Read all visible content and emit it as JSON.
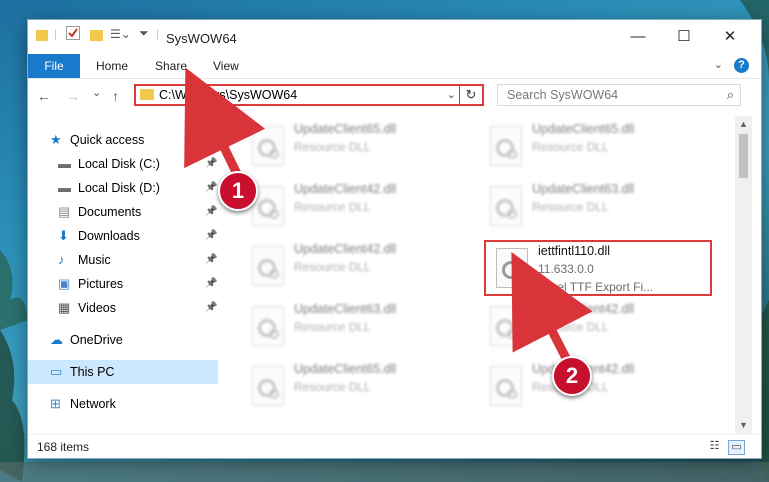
{
  "window": {
    "title": "SysWOW64",
    "controls": {
      "minimize": "—",
      "maximize": "☐",
      "close": "✕"
    }
  },
  "ribbon": {
    "tabs": [
      "File",
      "Home",
      "Share",
      "View"
    ],
    "help": "?"
  },
  "nav": {
    "back": "←",
    "forward": "→",
    "recent": "⌄",
    "up": "↑",
    "address": "C:\\Windows\\SysWOW64",
    "refresh": "↻",
    "search_placeholder": "Search SysWOW64"
  },
  "sidebar": {
    "items": [
      {
        "label": "Quick access",
        "icon": "star-icon",
        "pinned": false
      },
      {
        "label": "Local Disk (C:)",
        "icon": "drive-icon",
        "pinned": true
      },
      {
        "label": "Local Disk (D:)",
        "icon": "drive-icon",
        "pinned": true
      },
      {
        "label": "Documents",
        "icon": "documents-icon",
        "pinned": true
      },
      {
        "label": "Downloads",
        "icon": "download-icon",
        "pinned": true
      },
      {
        "label": "Music",
        "icon": "music-icon",
        "pinned": true
      },
      {
        "label": "Pictures",
        "icon": "pictures-icon",
        "pinned": true
      },
      {
        "label": "Videos",
        "icon": "videos-icon",
        "pinned": true
      },
      {
        "label": "OneDrive",
        "icon": "cloud-icon",
        "pinned": false
      },
      {
        "label": "This PC",
        "icon": "computer-icon",
        "pinned": false,
        "selected": true
      },
      {
        "label": "Network",
        "icon": "network-icon",
        "pinned": false
      }
    ]
  },
  "files": [
    {
      "name": "UpdateClient65.dll",
      "line2": "Resource DLL",
      "line3": ""
    },
    {
      "name": "UpdateClient65.dll",
      "line2": "Resource DLL",
      "line3": ""
    },
    {
      "name": "UpdateClient42.dll",
      "line2": "Resource DLL",
      "line3": ""
    },
    {
      "name": "UpdateClient63.dll",
      "line2": "Resource DLL",
      "line3": ""
    },
    {
      "name": "UpdateClient42.dll",
      "line2": "Resource DLL",
      "line3": ""
    },
    {
      "name": "iettfintl110.dll",
      "line2": "11.633.0.0",
      "line3": "Corel TTF Export Fi...",
      "highlighted": true
    },
    {
      "name": "UpdateClient63.dll",
      "line2": "Resource DLL",
      "line3": ""
    },
    {
      "name": "UpdateClient42.dll",
      "line2": "Resource DLL",
      "line3": ""
    },
    {
      "name": "UpdateClient65.dll",
      "line2": "Resource DLL",
      "line3": ""
    },
    {
      "name": "UpdateClient42.dll",
      "line2": "Resource DLL",
      "line3": ""
    }
  ],
  "status": {
    "item_count": "168 items"
  },
  "annotations": {
    "step1": "1",
    "step2": "2"
  },
  "colors": {
    "accent": "#1979ca",
    "highlight": "#d93a3a",
    "callout": "#c8102e",
    "selected": "#cce8ff"
  }
}
